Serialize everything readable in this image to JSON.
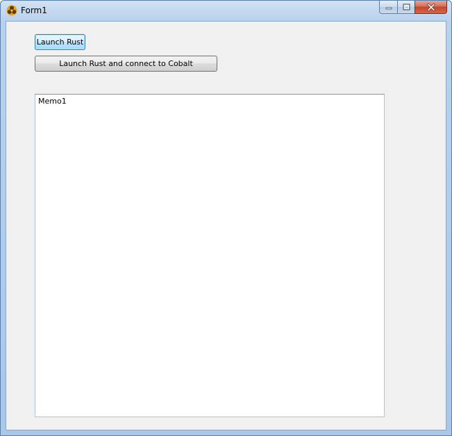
{
  "window": {
    "title": "Form1",
    "icon": "app-trefoil-icon",
    "caption_buttons": [
      "minimize-icon",
      "maximize-icon",
      "close-icon"
    ]
  },
  "buttons": {
    "launch_rust": "Launch Rust",
    "launch_rust_cobalt": "Launch Rust and connect to Cobalt"
  },
  "memo": {
    "text": "Memo1"
  },
  "colors": {
    "client_bg": "#f0f0f0",
    "focused_button_border": "#3c7fb1",
    "close_button": "#c4452c"
  }
}
